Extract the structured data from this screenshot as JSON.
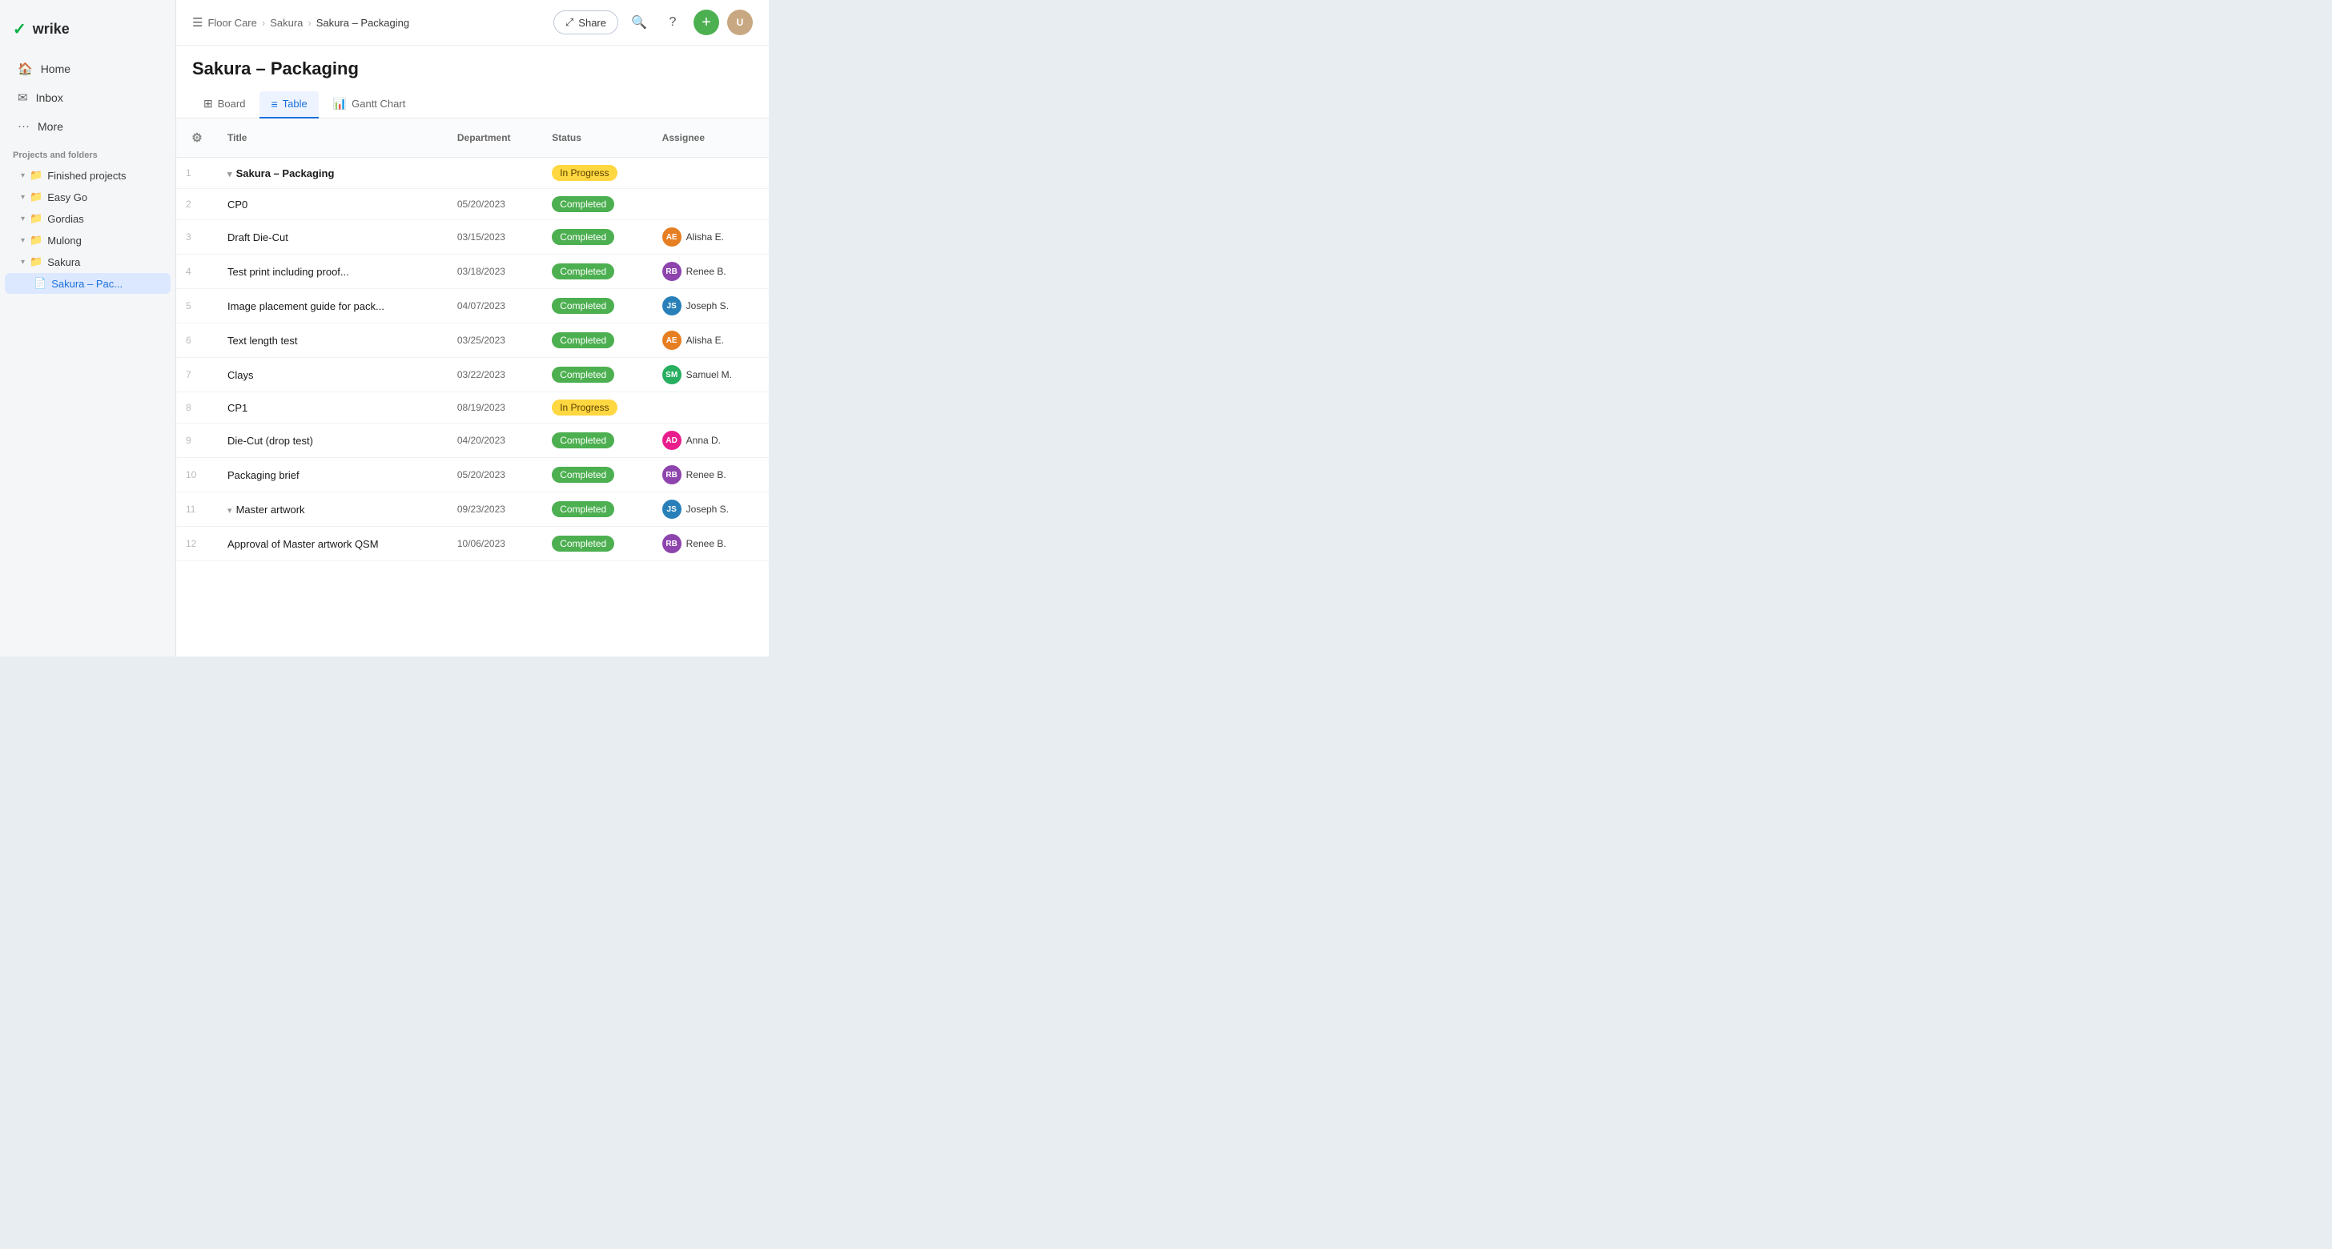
{
  "app": {
    "name": "wrike"
  },
  "sidebar": {
    "nav": [
      {
        "id": "home",
        "label": "Home",
        "icon": "🏠"
      },
      {
        "id": "inbox",
        "label": "Inbox",
        "icon": "✉️"
      },
      {
        "id": "more",
        "label": "More",
        "icon": "···"
      }
    ],
    "section_title": "Projects and folders",
    "tree": [
      {
        "id": "finished",
        "label": "Finished projects",
        "icon": "📁",
        "indent": 0,
        "has_chevron": true
      },
      {
        "id": "easygo",
        "label": "Easy Go",
        "icon": "📁",
        "indent": 0,
        "has_chevron": true
      },
      {
        "id": "gordias",
        "label": "Gordias",
        "icon": "📁",
        "indent": 0,
        "has_chevron": true
      },
      {
        "id": "mulong",
        "label": "Mulong",
        "icon": "📁",
        "indent": 0,
        "has_chevron": true
      },
      {
        "id": "sakura",
        "label": "Sakura",
        "icon": "📁",
        "indent": 0,
        "has_chevron": true
      },
      {
        "id": "sakura-pac",
        "label": "Sakura – Pac...",
        "icon": "📄",
        "indent": 1,
        "has_chevron": false,
        "active": true
      }
    ]
  },
  "header": {
    "breadcrumb": [
      "Floor Care",
      "Sakura",
      "Sakura – Packaging"
    ],
    "actions": {
      "share_label": "Share",
      "search_title": "Search",
      "help_title": "Help",
      "add_title": "Add",
      "add_icon": "+"
    }
  },
  "page": {
    "title": "Sakura – Packaging",
    "tabs": [
      {
        "id": "board",
        "label": "Board",
        "icon": "⊞",
        "active": false
      },
      {
        "id": "table",
        "label": "Table",
        "icon": "≡",
        "active": true
      },
      {
        "id": "gantt",
        "label": "Gantt Chart",
        "icon": "📊",
        "active": false
      }
    ]
  },
  "table": {
    "columns": [
      "",
      "Title",
      "Department",
      "Status",
      "Assignee"
    ],
    "rows": [
      {
        "num": "1",
        "title": "Sakura – Packaging",
        "is_project": true,
        "has_expand": true,
        "department": "",
        "status": "In Progress",
        "status_type": "in-progress",
        "assignee": null,
        "assignee_class": ""
      },
      {
        "num": "2",
        "title": "CP0",
        "is_project": false,
        "has_expand": false,
        "department": "05/20/2023",
        "status": "Completed",
        "status_type": "completed",
        "assignee": null,
        "assignee_class": ""
      },
      {
        "num": "3",
        "title": "Draft Die-Cut",
        "is_project": false,
        "has_expand": false,
        "department": "03/15/2023",
        "status": "Completed",
        "status_type": "completed",
        "assignee": "Alisha E.",
        "assignee_class": "av-alisha",
        "assignee_initials": "AE"
      },
      {
        "num": "4",
        "title": "Test print including proof...",
        "is_project": false,
        "has_expand": false,
        "department": "03/18/2023",
        "status": "Completed",
        "status_type": "completed",
        "assignee": "Renee B.",
        "assignee_class": "av-renee",
        "assignee_initials": "RB"
      },
      {
        "num": "5",
        "title": "Image placement guide for pack...",
        "is_project": false,
        "has_expand": false,
        "department": "04/07/2023",
        "status": "Completed",
        "status_type": "completed",
        "assignee": "Joseph S.",
        "assignee_class": "av-joseph",
        "assignee_initials": "JS"
      },
      {
        "num": "6",
        "title": "Text length test",
        "is_project": false,
        "has_expand": false,
        "department": "03/25/2023",
        "status": "Completed",
        "status_type": "completed",
        "assignee": "Alisha E.",
        "assignee_class": "av-alisha",
        "assignee_initials": "AE"
      },
      {
        "num": "7",
        "title": "Clays",
        "is_project": false,
        "has_expand": false,
        "department": "03/22/2023",
        "status": "Completed",
        "status_type": "completed",
        "assignee": "Samuel M.",
        "assignee_class": "av-samuel",
        "assignee_initials": "SM"
      },
      {
        "num": "8",
        "title": "CP1",
        "is_project": false,
        "has_expand": false,
        "department": "08/19/2023",
        "status": "In Progress",
        "status_type": "in-progress",
        "assignee": null,
        "assignee_class": ""
      },
      {
        "num": "9",
        "title": "Die-Cut (drop test)",
        "is_project": false,
        "has_expand": false,
        "department": "04/20/2023",
        "status": "Completed",
        "status_type": "completed",
        "assignee": "Anna D.",
        "assignee_class": "av-anna",
        "assignee_initials": "AD"
      },
      {
        "num": "10",
        "title": "Packaging brief",
        "is_project": false,
        "has_expand": false,
        "department": "05/20/2023",
        "status": "Completed",
        "status_type": "completed",
        "assignee": "Renee B.",
        "assignee_class": "av-renee",
        "assignee_initials": "RB"
      },
      {
        "num": "11",
        "title": "Master artwork",
        "is_project": false,
        "has_expand": true,
        "department": "09/23/2023",
        "status": "Completed",
        "status_type": "completed",
        "assignee": "Joseph S.",
        "assignee_class": "av-joseph",
        "assignee_initials": "JS"
      },
      {
        "num": "12",
        "title": "Approval of Master artwork QSM",
        "is_project": false,
        "has_expand": false,
        "department": "10/06/2023",
        "status": "Completed",
        "status_type": "completed",
        "assignee": "Renee B.",
        "assignee_class": "av-renee",
        "assignee_initials": "RB"
      }
    ]
  }
}
